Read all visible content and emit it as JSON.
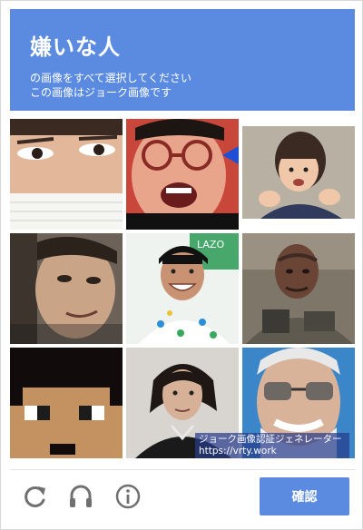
{
  "header": {
    "title": "嫌いな人",
    "subtitle_line1": "の画像をすべて選択してください",
    "subtitle_line2": "この画像はジョーク画像です"
  },
  "grid": {
    "tiles": [
      {
        "name": "tile-1",
        "description_icon": "face-closeup-icon"
      },
      {
        "name": "tile-2",
        "description_icon": "face-glasses-icon"
      },
      {
        "name": "tile-3",
        "description_icon": "child-icon"
      },
      {
        "name": "tile-4",
        "description_icon": "face-sideways-icon"
      },
      {
        "name": "tile-5",
        "description_icon": "smiling-man-icon"
      },
      {
        "name": "tile-6",
        "description_icon": "actor-icon"
      },
      {
        "name": "tile-7",
        "description_icon": "pixel-face-icon"
      },
      {
        "name": "tile-8",
        "description_icon": "man-portrait-icon"
      },
      {
        "name": "tile-9",
        "description_icon": "old-man-icon"
      }
    ]
  },
  "watermark": {
    "line1": "ジョーク画像認証ジェネレーター",
    "line2": "https://vrty.work"
  },
  "footer": {
    "verify_label": "確認",
    "icons": [
      "reload-icon",
      "audio-icon",
      "info-icon"
    ]
  },
  "colors": {
    "accent": "#5b8be0",
    "icon_gray": "#707070"
  }
}
